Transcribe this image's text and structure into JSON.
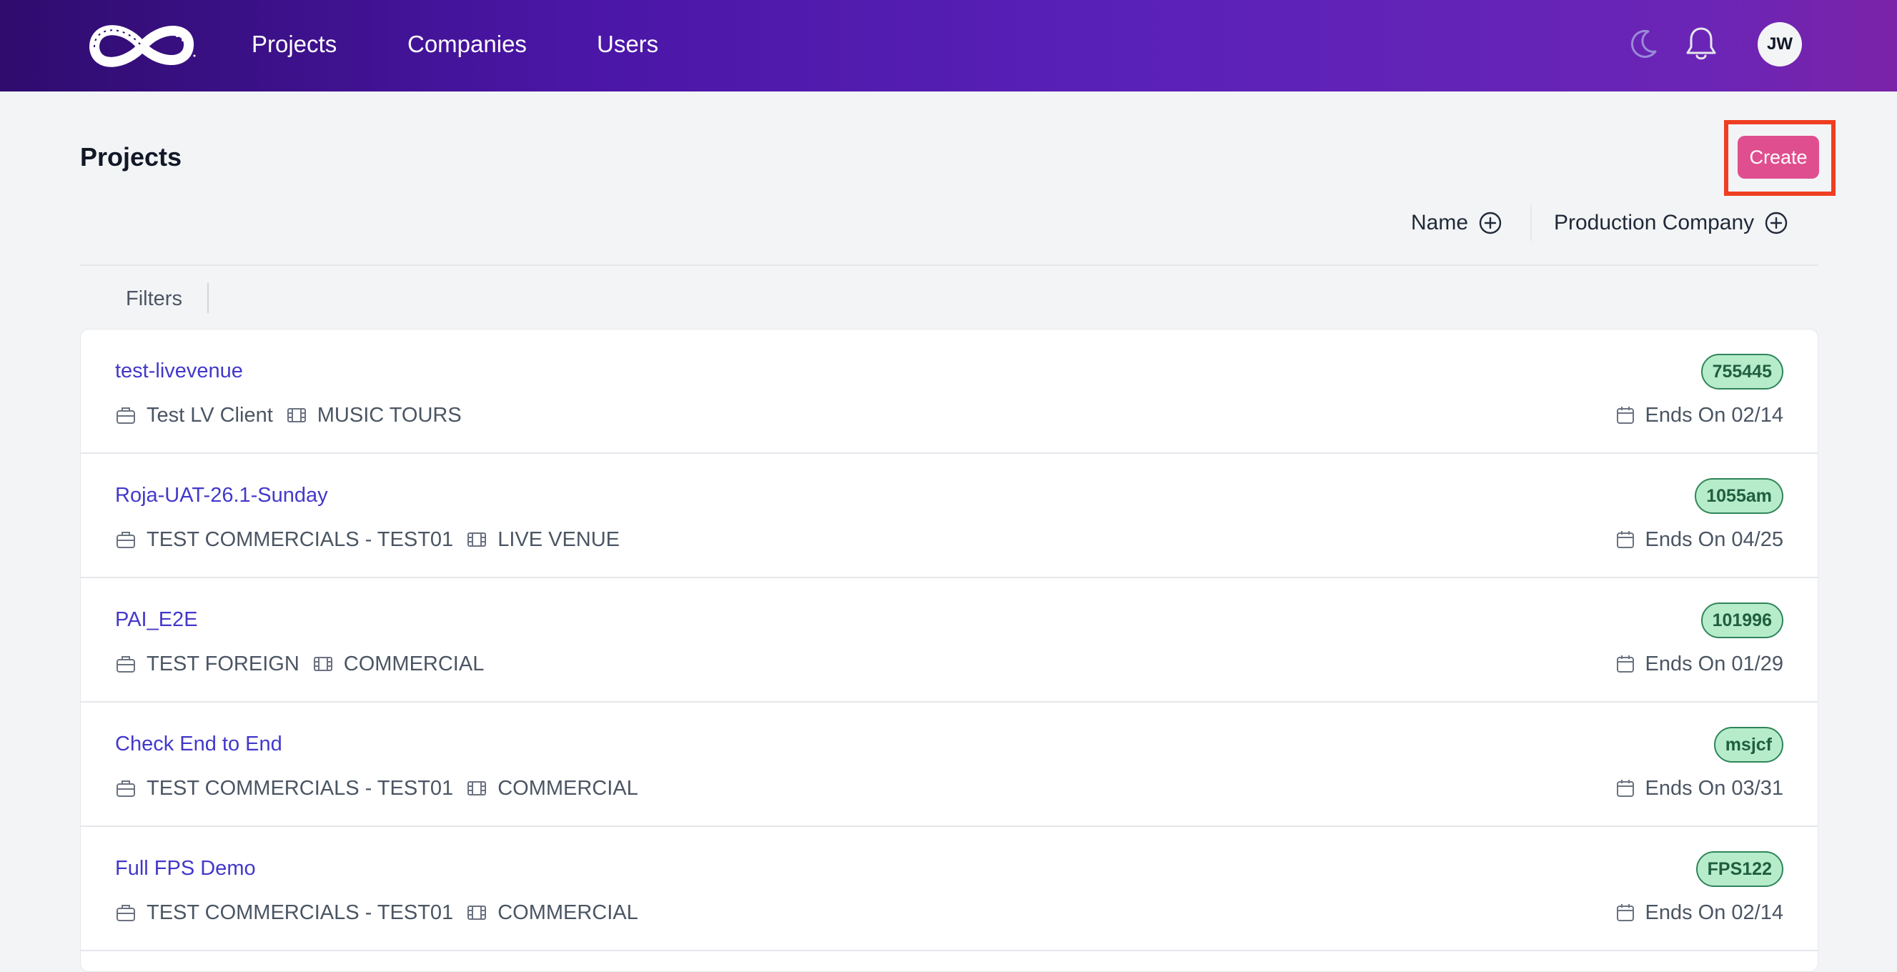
{
  "nav": {
    "items": [
      {
        "label": "Projects"
      },
      {
        "label": "Companies"
      },
      {
        "label": "Users"
      }
    ],
    "icons": {
      "theme": "moon-icon",
      "notifications": "bell-icon"
    },
    "avatar_initials": "JW"
  },
  "page": {
    "title": "Projects",
    "create_label": "Create",
    "sort": {
      "name_label": "Name",
      "company_label": "Production Company"
    },
    "filters_label": "Filters"
  },
  "projects": [
    {
      "name": "test-livevenue",
      "client": "Test LV Client",
      "type": "MUSIC TOURS",
      "code": "755445",
      "ends": "Ends On 02/14"
    },
    {
      "name": "Roja-UAT-26.1-Sunday",
      "client": "TEST COMMERCIALS - TEST01",
      "type": "LIVE VENUE",
      "code": "1055am",
      "ends": "Ends On 04/25"
    },
    {
      "name": "PAI_E2E",
      "client": "TEST FOREIGN",
      "type": "COMMERCIAL",
      "code": "101996",
      "ends": "Ends On 01/29"
    },
    {
      "name": "Check End to End",
      "client": "TEST COMMERCIALS - TEST01",
      "type": "COMMERCIAL",
      "code": "msjcf",
      "ends": "Ends On 03/31"
    },
    {
      "name": "Full FPS Demo",
      "client": "TEST COMMERCIALS - TEST01",
      "type": "COMMERCIAL",
      "code": "FPS122",
      "ends": "Ends On 02/14"
    }
  ],
  "colors": {
    "accent_button": "#df4f8f",
    "link": "#4338ca",
    "badge_bg": "#b7eccb",
    "highlight_box": "#ef3e22"
  }
}
